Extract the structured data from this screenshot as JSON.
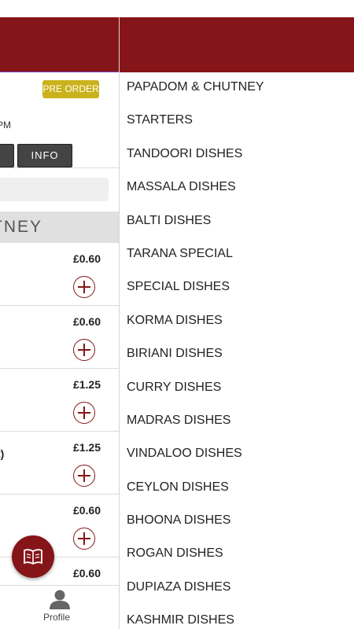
{
  "left_page": {
    "preorder_label": "PRE ORDER",
    "hours_text": "PM",
    "info_button": "INFO",
    "section_title": "TNEY",
    "items": [
      {
        "name": "",
        "price": "£0.60"
      },
      {
        "name": "",
        "price": "£0.60"
      },
      {
        "name": "",
        "price": "£1.25"
      },
      {
        "name": "t)",
        "price": "£1.25"
      },
      {
        "name": "",
        "price": "£0.60"
      },
      {
        "name": "",
        "price": "£0.60"
      }
    ],
    "menu_fab_icon": "book-icon",
    "nav": {
      "profile_label": "Profile",
      "profile_icon": "person-icon"
    }
  },
  "drawer": {
    "categories": [
      "PAPADOM & CHUTNEY",
      "STARTERS",
      "TANDOORI DISHES",
      "MASSALA DISHES",
      "BALTI DISHES",
      "TARANA SPECIAL",
      "SPECIAL DISHES",
      "KORMA DISHES",
      "BIRIANI DISHES",
      "CURRY DISHES",
      "MADRAS DISHES",
      "VINDALOO DISHES",
      "CEYLON DISHES",
      "BHOONA DISHES",
      "ROGAN DISHES",
      "DUPIAZA DISHES",
      "KASHMIR DISHES"
    ]
  },
  "colors": {
    "brand": "#851518",
    "preorder": "#c9b21b"
  }
}
